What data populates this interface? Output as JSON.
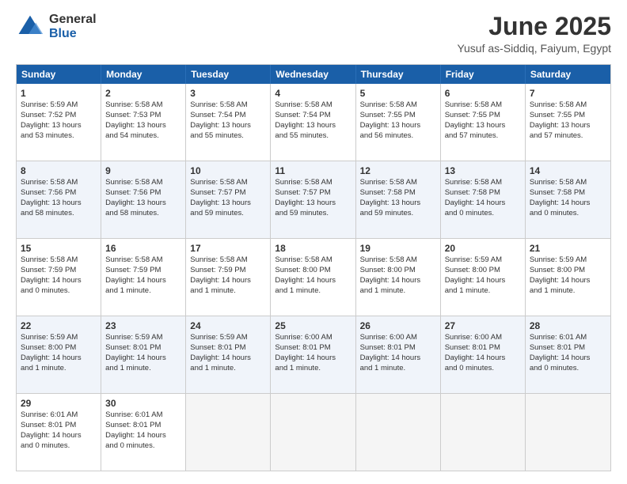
{
  "logo": {
    "general": "General",
    "blue": "Blue"
  },
  "header": {
    "month": "June 2025",
    "location": "Yusuf as-Siddiq, Faiyum, Egypt"
  },
  "weekdays": [
    "Sunday",
    "Monday",
    "Tuesday",
    "Wednesday",
    "Thursday",
    "Friday",
    "Saturday"
  ],
  "rows": [
    [
      {
        "day": "1",
        "lines": [
          "Sunrise: 5:59 AM",
          "Sunset: 7:52 PM",
          "Daylight: 13 hours",
          "and 53 minutes."
        ]
      },
      {
        "day": "2",
        "lines": [
          "Sunrise: 5:58 AM",
          "Sunset: 7:53 PM",
          "Daylight: 13 hours",
          "and 54 minutes."
        ]
      },
      {
        "day": "3",
        "lines": [
          "Sunrise: 5:58 AM",
          "Sunset: 7:54 PM",
          "Daylight: 13 hours",
          "and 55 minutes."
        ]
      },
      {
        "day": "4",
        "lines": [
          "Sunrise: 5:58 AM",
          "Sunset: 7:54 PM",
          "Daylight: 13 hours",
          "and 55 minutes."
        ]
      },
      {
        "day": "5",
        "lines": [
          "Sunrise: 5:58 AM",
          "Sunset: 7:55 PM",
          "Daylight: 13 hours",
          "and 56 minutes."
        ]
      },
      {
        "day": "6",
        "lines": [
          "Sunrise: 5:58 AM",
          "Sunset: 7:55 PM",
          "Daylight: 13 hours",
          "and 57 minutes."
        ]
      },
      {
        "day": "7",
        "lines": [
          "Sunrise: 5:58 AM",
          "Sunset: 7:55 PM",
          "Daylight: 13 hours",
          "and 57 minutes."
        ]
      }
    ],
    [
      {
        "day": "8",
        "lines": [
          "Sunrise: 5:58 AM",
          "Sunset: 7:56 PM",
          "Daylight: 13 hours",
          "and 58 minutes."
        ]
      },
      {
        "day": "9",
        "lines": [
          "Sunrise: 5:58 AM",
          "Sunset: 7:56 PM",
          "Daylight: 13 hours",
          "and 58 minutes."
        ]
      },
      {
        "day": "10",
        "lines": [
          "Sunrise: 5:58 AM",
          "Sunset: 7:57 PM",
          "Daylight: 13 hours",
          "and 59 minutes."
        ]
      },
      {
        "day": "11",
        "lines": [
          "Sunrise: 5:58 AM",
          "Sunset: 7:57 PM",
          "Daylight: 13 hours",
          "and 59 minutes."
        ]
      },
      {
        "day": "12",
        "lines": [
          "Sunrise: 5:58 AM",
          "Sunset: 7:58 PM",
          "Daylight: 13 hours",
          "and 59 minutes."
        ]
      },
      {
        "day": "13",
        "lines": [
          "Sunrise: 5:58 AM",
          "Sunset: 7:58 PM",
          "Daylight: 14 hours",
          "and 0 minutes."
        ]
      },
      {
        "day": "14",
        "lines": [
          "Sunrise: 5:58 AM",
          "Sunset: 7:58 PM",
          "Daylight: 14 hours",
          "and 0 minutes."
        ]
      }
    ],
    [
      {
        "day": "15",
        "lines": [
          "Sunrise: 5:58 AM",
          "Sunset: 7:59 PM",
          "Daylight: 14 hours",
          "and 0 minutes."
        ]
      },
      {
        "day": "16",
        "lines": [
          "Sunrise: 5:58 AM",
          "Sunset: 7:59 PM",
          "Daylight: 14 hours",
          "and 1 minute."
        ]
      },
      {
        "day": "17",
        "lines": [
          "Sunrise: 5:58 AM",
          "Sunset: 7:59 PM",
          "Daylight: 14 hours",
          "and 1 minute."
        ]
      },
      {
        "day": "18",
        "lines": [
          "Sunrise: 5:58 AM",
          "Sunset: 8:00 PM",
          "Daylight: 14 hours",
          "and 1 minute."
        ]
      },
      {
        "day": "19",
        "lines": [
          "Sunrise: 5:58 AM",
          "Sunset: 8:00 PM",
          "Daylight: 14 hours",
          "and 1 minute."
        ]
      },
      {
        "day": "20",
        "lines": [
          "Sunrise: 5:59 AM",
          "Sunset: 8:00 PM",
          "Daylight: 14 hours",
          "and 1 minute."
        ]
      },
      {
        "day": "21",
        "lines": [
          "Sunrise: 5:59 AM",
          "Sunset: 8:00 PM",
          "Daylight: 14 hours",
          "and 1 minute."
        ]
      }
    ],
    [
      {
        "day": "22",
        "lines": [
          "Sunrise: 5:59 AM",
          "Sunset: 8:00 PM",
          "Daylight: 14 hours",
          "and 1 minute."
        ]
      },
      {
        "day": "23",
        "lines": [
          "Sunrise: 5:59 AM",
          "Sunset: 8:01 PM",
          "Daylight: 14 hours",
          "and 1 minute."
        ]
      },
      {
        "day": "24",
        "lines": [
          "Sunrise: 5:59 AM",
          "Sunset: 8:01 PM",
          "Daylight: 14 hours",
          "and 1 minute."
        ]
      },
      {
        "day": "25",
        "lines": [
          "Sunrise: 6:00 AM",
          "Sunset: 8:01 PM",
          "Daylight: 14 hours",
          "and 1 minute."
        ]
      },
      {
        "day": "26",
        "lines": [
          "Sunrise: 6:00 AM",
          "Sunset: 8:01 PM",
          "Daylight: 14 hours",
          "and 1 minute."
        ]
      },
      {
        "day": "27",
        "lines": [
          "Sunrise: 6:00 AM",
          "Sunset: 8:01 PM",
          "Daylight: 14 hours",
          "and 0 minutes."
        ]
      },
      {
        "day": "28",
        "lines": [
          "Sunrise: 6:01 AM",
          "Sunset: 8:01 PM",
          "Daylight: 14 hours",
          "and 0 minutes."
        ]
      }
    ],
    [
      {
        "day": "29",
        "lines": [
          "Sunrise: 6:01 AM",
          "Sunset: 8:01 PM",
          "Daylight: 14 hours",
          "and 0 minutes."
        ]
      },
      {
        "day": "30",
        "lines": [
          "Sunrise: 6:01 AM",
          "Sunset: 8:01 PM",
          "Daylight: 14 hours",
          "and 0 minutes."
        ]
      },
      null,
      null,
      null,
      null,
      null
    ]
  ]
}
